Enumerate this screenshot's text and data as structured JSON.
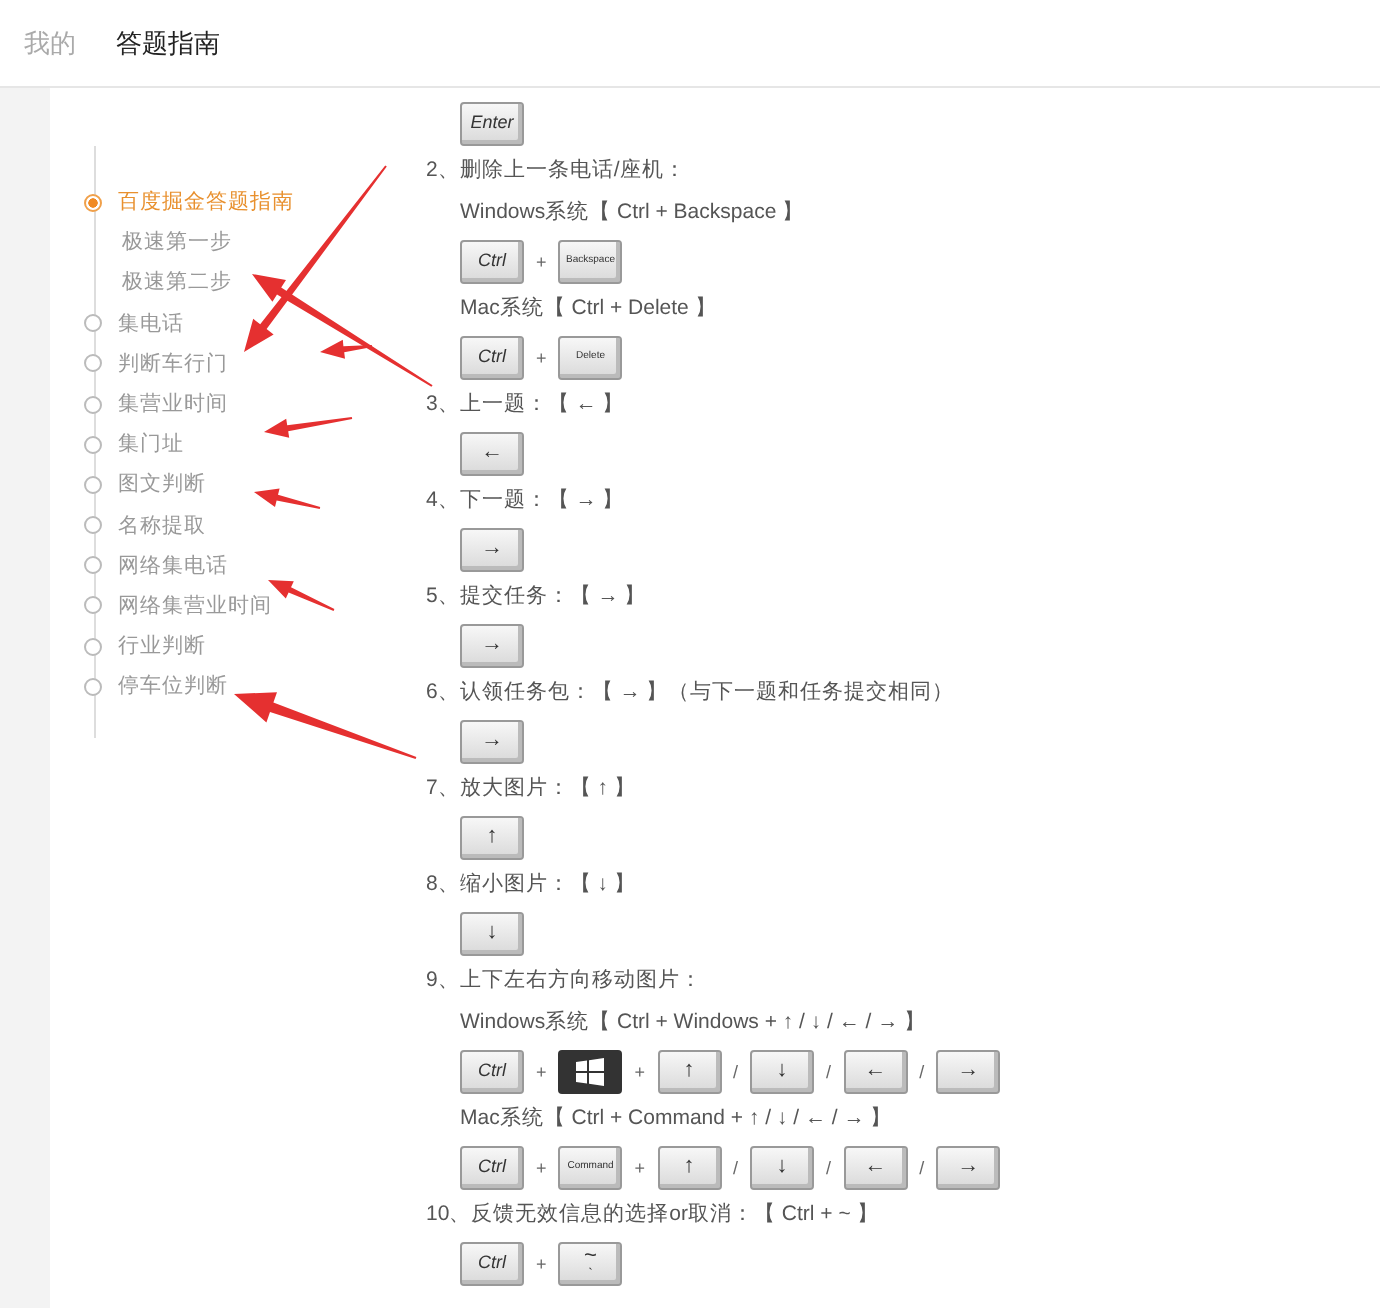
{
  "tabs": [
    {
      "label": "我的",
      "selected": false
    },
    {
      "label": "答题指南",
      "selected": true
    }
  ],
  "sidebar": {
    "items": [
      {
        "label": "百度掘金答题指南",
        "selected": true,
        "children": [
          {
            "label": "极速第一步",
            "selected": false
          },
          {
            "label": "极速第二步",
            "selected": false
          }
        ]
      },
      {
        "label": "集电话",
        "selected": false
      },
      {
        "label": "判断车行门",
        "selected": false
      },
      {
        "label": "集营业时间",
        "selected": false
      },
      {
        "label": "集门址",
        "selected": false
      },
      {
        "label": "图文判断",
        "selected": false
      },
      {
        "label": "名称提取",
        "selected": false
      },
      {
        "label": "网络集电话",
        "selected": false
      },
      {
        "label": "网络集营业时间",
        "selected": false
      },
      {
        "label": "行业判断",
        "selected": false
      },
      {
        "label": "停车位判断",
        "selected": false
      }
    ]
  },
  "guide": {
    "blocks": [
      {
        "kind": "keys",
        "keys": [
          {
            "kind": "key",
            "label": "Enter"
          }
        ]
      },
      {
        "kind": "heading",
        "text": "2、删除上一条电话/座机："
      },
      {
        "kind": "note",
        "text": "Windows系统【 Ctrl + Backspace 】"
      },
      {
        "kind": "keys",
        "keys": [
          {
            "kind": "key",
            "label": "Ctrl"
          },
          {
            "kind": "sep",
            "label": "+"
          },
          {
            "kind": "key",
            "label": "Backspace"
          }
        ]
      },
      {
        "kind": "note",
        "text": "Mac系统【 Ctrl + Delete 】"
      },
      {
        "kind": "keys",
        "keys": [
          {
            "kind": "key",
            "label": "Ctrl"
          },
          {
            "kind": "sep",
            "label": "+"
          },
          {
            "kind": "key",
            "label": "Delete"
          }
        ]
      },
      {
        "kind": "heading",
        "text": "3、上一题：【 ← 】"
      },
      {
        "kind": "keys",
        "keys": [
          {
            "kind": "key",
            "label": "←"
          }
        ]
      },
      {
        "kind": "heading",
        "text": "4、下一题：【 → 】"
      },
      {
        "kind": "keys",
        "keys": [
          {
            "kind": "key",
            "label": "→"
          }
        ]
      },
      {
        "kind": "heading",
        "text": "5、提交任务：【 → 】"
      },
      {
        "kind": "keys",
        "keys": [
          {
            "kind": "key",
            "label": "→"
          }
        ]
      },
      {
        "kind": "heading",
        "text": "6、认领任务包：【 → 】（与下一题和任务提交相同）"
      },
      {
        "kind": "keys",
        "keys": [
          {
            "kind": "key",
            "label": "→"
          }
        ]
      },
      {
        "kind": "heading",
        "text": "7、放大图片：【 ↑ 】"
      },
      {
        "kind": "keys",
        "keys": [
          {
            "kind": "key",
            "label": "↑"
          }
        ]
      },
      {
        "kind": "heading",
        "text": "8、缩小图片：【 ↓ 】"
      },
      {
        "kind": "keys",
        "keys": [
          {
            "kind": "key",
            "label": "↓"
          }
        ]
      },
      {
        "kind": "heading",
        "text": "9、上下左右方向移动图片："
      },
      {
        "kind": "note",
        "text": "Windows系统【 Ctrl + Windows + ↑ / ↓ / ← / → 】"
      },
      {
        "kind": "keys",
        "keys": [
          {
            "kind": "key",
            "label": "Ctrl"
          },
          {
            "kind": "sep",
            "label": "+"
          },
          {
            "kind": "windows-key"
          },
          {
            "kind": "sep",
            "label": "+"
          },
          {
            "kind": "key",
            "label": "↑"
          },
          {
            "kind": "sep",
            "label": "/"
          },
          {
            "kind": "key",
            "label": "↓"
          },
          {
            "kind": "sep",
            "label": "/"
          },
          {
            "kind": "key",
            "label": "←"
          },
          {
            "kind": "sep",
            "label": "/"
          },
          {
            "kind": "key",
            "label": "→"
          }
        ]
      },
      {
        "kind": "note",
        "text": "Mac系统【 Ctrl + Command + ↑ / ↓ / ← / → 】"
      },
      {
        "kind": "keys",
        "keys": [
          {
            "kind": "key",
            "label": "Ctrl"
          },
          {
            "kind": "sep",
            "label": "+"
          },
          {
            "kind": "key",
            "label": "Command"
          },
          {
            "kind": "sep",
            "label": "+"
          },
          {
            "kind": "key",
            "label": "↑"
          },
          {
            "kind": "sep",
            "label": "/"
          },
          {
            "kind": "key",
            "label": "↓"
          },
          {
            "kind": "sep",
            "label": "/"
          },
          {
            "kind": "key",
            "label": "←"
          },
          {
            "kind": "sep",
            "label": "/"
          },
          {
            "kind": "key",
            "label": "→"
          }
        ]
      },
      {
        "kind": "heading",
        "text": "10、反馈无效信息的选择or取消：【 Ctrl + ~ 】"
      },
      {
        "kind": "keys",
        "keys": [
          {
            "kind": "key",
            "label": "Ctrl"
          },
          {
            "kind": "sep",
            "label": "+"
          },
          {
            "kind": "key",
            "label": "~",
            "sub": "`"
          }
        ]
      }
    ]
  }
}
